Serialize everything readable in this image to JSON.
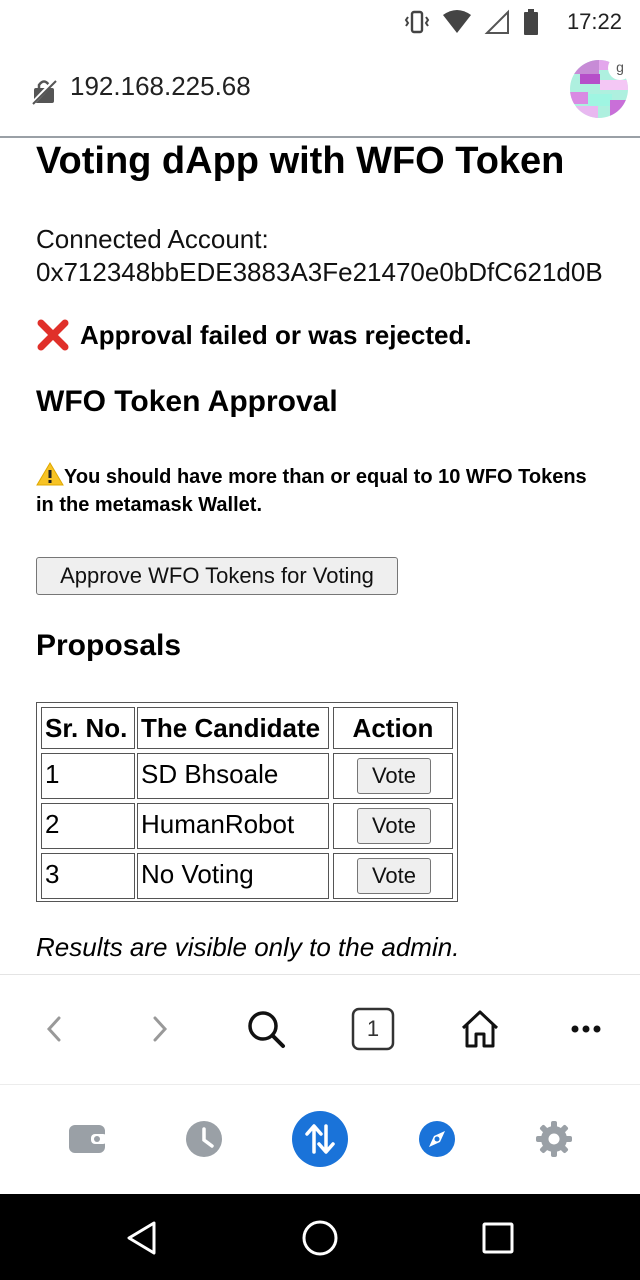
{
  "status_bar": {
    "time": "17:22"
  },
  "address_bar": {
    "url": "192.168.225.68",
    "avatar_badge": "g"
  },
  "page": {
    "title": "Voting dApp with WFO Token",
    "account_label": "Connected Account:",
    "account_address": "0x712348bbEDE3883A3Fe21470e0bDfC621d0B",
    "error_message": "Approval failed or was rejected.",
    "approval_heading": "WFO Token Approval",
    "warning_text": "You should have more than or equal to 10 WFO Tokens in the metamask Wallet.",
    "approve_button": "Approve WFO Tokens for Voting",
    "proposals_heading": "Proposals",
    "table": {
      "headers": [
        "Sr. No.",
        "The Candidate",
        "Action"
      ],
      "rows": [
        {
          "sr": "1",
          "candidate": "SD Bhsoale",
          "action": "Vote"
        },
        {
          "sr": "2",
          "candidate": "HumanRobot",
          "action": "Vote"
        },
        {
          "sr": "3",
          "candidate": "No Voting",
          "action": "Vote"
        }
      ]
    },
    "results_note": "Results are visible only to the admin."
  },
  "toolbar": {
    "tab_count": "1",
    "icons": [
      "back-icon",
      "forward-icon",
      "search-icon",
      "tabs-icon",
      "home-icon",
      "more-icon"
    ]
  },
  "app_bar": {
    "icons": [
      "wallet-icon",
      "history-icon",
      "swap-icon",
      "explore-icon",
      "settings-icon"
    ],
    "accent": "#1a73d9"
  },
  "nav_bar": {
    "icons": [
      "nav-back-icon",
      "nav-home-icon",
      "nav-recents-icon"
    ]
  }
}
